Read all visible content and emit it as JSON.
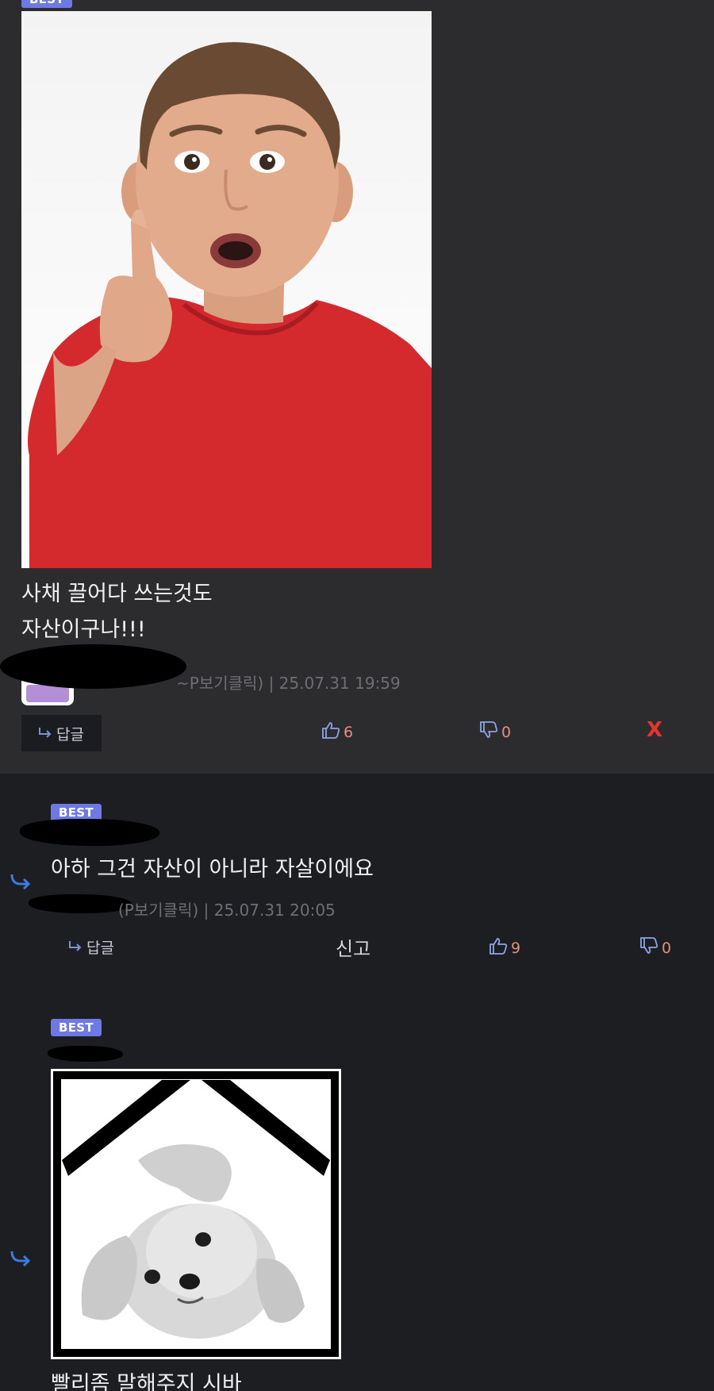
{
  "comment1": {
    "badge": "BEST",
    "text_line1": "사채 끌어다 쓰는것도",
    "text_line2": "자산이구나!!!",
    "meta": "~P보기클릭) | 25.07.31 19:59",
    "reply_label": "답글",
    "likes": "6",
    "dislikes": "0",
    "delete_label": "X"
  },
  "comment2": {
    "badge": "BEST",
    "text": "아하 그건 자산이 아니라 자살이에요",
    "meta": "(P보기클릭) | 25.07.31 20:05",
    "reply_label": "답글",
    "report_label": "신고",
    "likes": "9",
    "dislikes": "0"
  },
  "comment3": {
    "badge": "BEST",
    "text": "빨리좀 말해주지 시바"
  },
  "icons": {
    "reply": "reply-arrow-icon",
    "like": "thumbs-up-icon",
    "dislike": "thumbs-down-icon"
  },
  "colors": {
    "badge": "#6e79e4",
    "like_count": "#e58d7e",
    "delete": "#e3372c",
    "reply_arrow": "#3c7be0"
  }
}
